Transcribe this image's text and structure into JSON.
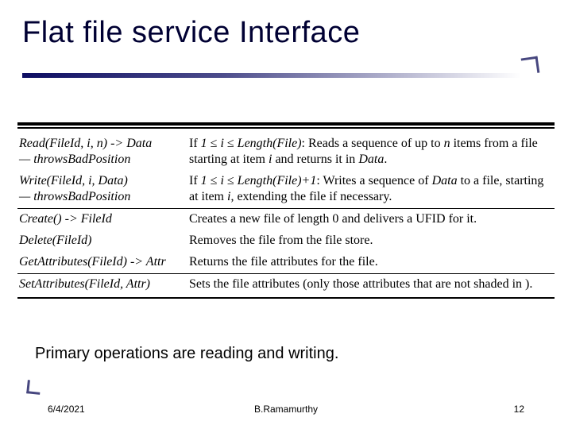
{
  "title": "Flat file service Interface",
  "rows": [
    {
      "sig": "Read(FileId, i, n) -> Data\n— throwsBadPosition",
      "desc_html": "If <span class='it'>1 ≤ i ≤ Length(File)</span>: Reads a sequence of up to <span class='it'>n</span> items from a file starting at item <span class='it'>i</span> and returns it in <span class='it'>Data</span>."
    },
    {
      "sig": "Write(FileId, i, Data)\n— throwsBadPosition",
      "desc_html": "If <span class='it'>1 ≤ i ≤ Length(File)+1</span>: Writes a sequence of <span class='it'>Data</span> to a file, starting at item <span class='it'>i</span>, extending the file if necessary.",
      "underline": true
    },
    {
      "sig": "Create() -> FileId",
      "desc_html": "Creates a new file of length 0 and delivers a UFID for it."
    },
    {
      "sig": "Delete(FileId)",
      "desc_html": "Removes the file from the file store."
    },
    {
      "sig": "GetAttributes(FileId) -> Attr",
      "desc_html": "Returns the file attributes for the file.",
      "underline": true
    },
    {
      "sig": "SetAttributes(FileId, Attr)",
      "desc_html": "Sets the file attributes (only those attributes that are not shaded in )."
    }
  ],
  "summary": "Primary operations are reading and writing.",
  "footer": {
    "date": "6/4/2021",
    "center": "B.Ramamurthy",
    "num": "12"
  }
}
